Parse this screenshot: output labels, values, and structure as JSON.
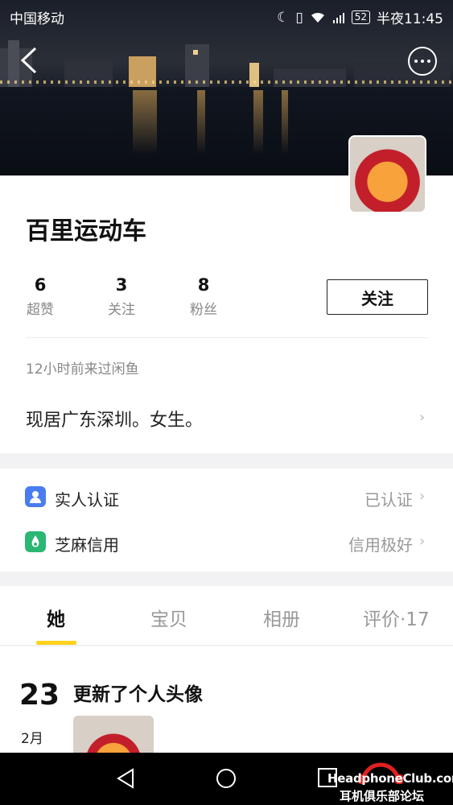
{
  "status_bar": {
    "carrier": "中国移动",
    "battery": "52",
    "time": "半夜11:45"
  },
  "profile": {
    "name": "百里运动车",
    "stats": [
      {
        "value": "6",
        "label": "超赞"
      },
      {
        "value": "3",
        "label": "关注"
      },
      {
        "value": "8",
        "label": "粉丝"
      }
    ],
    "follow_label": "关注",
    "last_seen": "12小时前来过闲鱼",
    "bio": "现居广东深圳。女生。"
  },
  "verification": [
    {
      "label": "实人认证",
      "value": "已认证",
      "icon": "person-id-icon",
      "color": "#4a7cf0"
    },
    {
      "label": "芝麻信用",
      "value": "信用极好",
      "icon": "sesame-credit-icon",
      "color": "#2bb673"
    }
  ],
  "tabs": [
    {
      "label": "她",
      "active": true
    },
    {
      "label": "宝贝",
      "active": false
    },
    {
      "label": "相册",
      "active": false
    },
    {
      "label": "评价·17",
      "active": false
    }
  ],
  "feed": {
    "day": "23",
    "month": "2月",
    "title": "更新了个人头像"
  },
  "watermark": {
    "en_text": "HeadphoneClub.com",
    "cn_text": "耳机俱乐部论坛"
  },
  "colors": {
    "accent_yellow": "#ffd21e",
    "text_dark": "#111111",
    "text_muted": "#888888"
  }
}
